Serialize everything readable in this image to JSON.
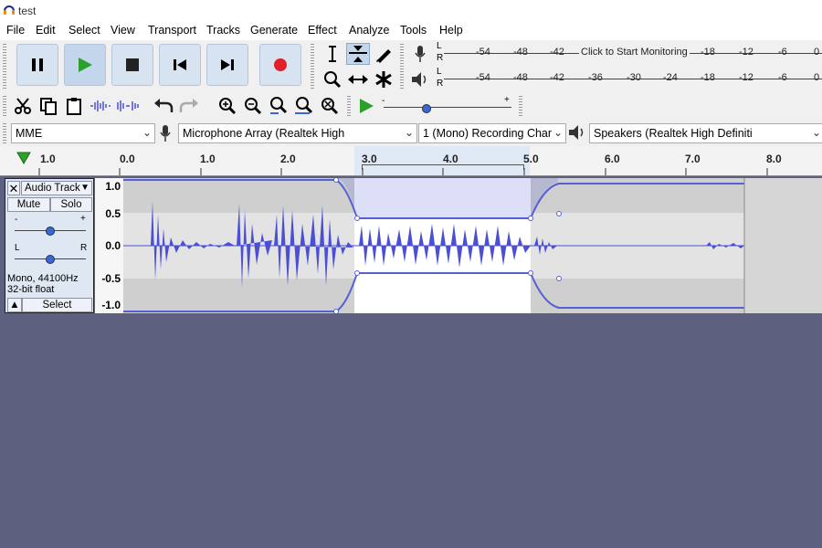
{
  "window": {
    "title": "test"
  },
  "menu": [
    "File",
    "Edit",
    "Select",
    "View",
    "Transport",
    "Tracks",
    "Generate",
    "Effect",
    "Analyze",
    "Tools",
    "Help"
  ],
  "meters": {
    "record_labels": [
      "-54",
      "-48",
      "-42",
      "Click to Start Monitoring",
      "-18",
      "-12",
      "-6",
      "0"
    ],
    "play_labels": [
      "-54",
      "-48",
      "-42",
      "-36",
      "-30",
      "-24",
      "-18",
      "-12",
      "-6",
      "0"
    ],
    "channel_left": "L",
    "channel_right": "R"
  },
  "playback_speed": {
    "min_label": "-",
    "max_label": "+"
  },
  "devices": {
    "host": "MME",
    "recording_device": "Microphone Array (Realtek High",
    "channels": "1 (Mono) Recording Char",
    "playback_device": "Speakers (Realtek High Definiti"
  },
  "ruler": {
    "ticks": [
      "1.0",
      "0.0",
      "1.0",
      "2.0",
      "3.0",
      "4.0",
      "5.0",
      "6.0",
      "7.0",
      "8.0"
    ],
    "selection_start_sec": 2.9,
    "selection_end_sec": 5.0
  },
  "track": {
    "name": "Audio Track",
    "mute_label": "Mute",
    "solo_label": "Solo",
    "gain_minus": "-",
    "gain_plus": "+",
    "pan_left": "L",
    "pan_right": "R",
    "info_rate": "Mono, 44100Hz",
    "info_format": "32-bit float",
    "select_label": "Select",
    "scale_labels": [
      "1.0",
      "0.5",
      "0.0",
      "-0.5",
      "-1.0"
    ]
  },
  "colors": {
    "waveform": "#4a4fd6",
    "background": "#5e6080",
    "record": "#e0202a",
    "play": "#2ca02c",
    "selection": "#ffffff"
  }
}
